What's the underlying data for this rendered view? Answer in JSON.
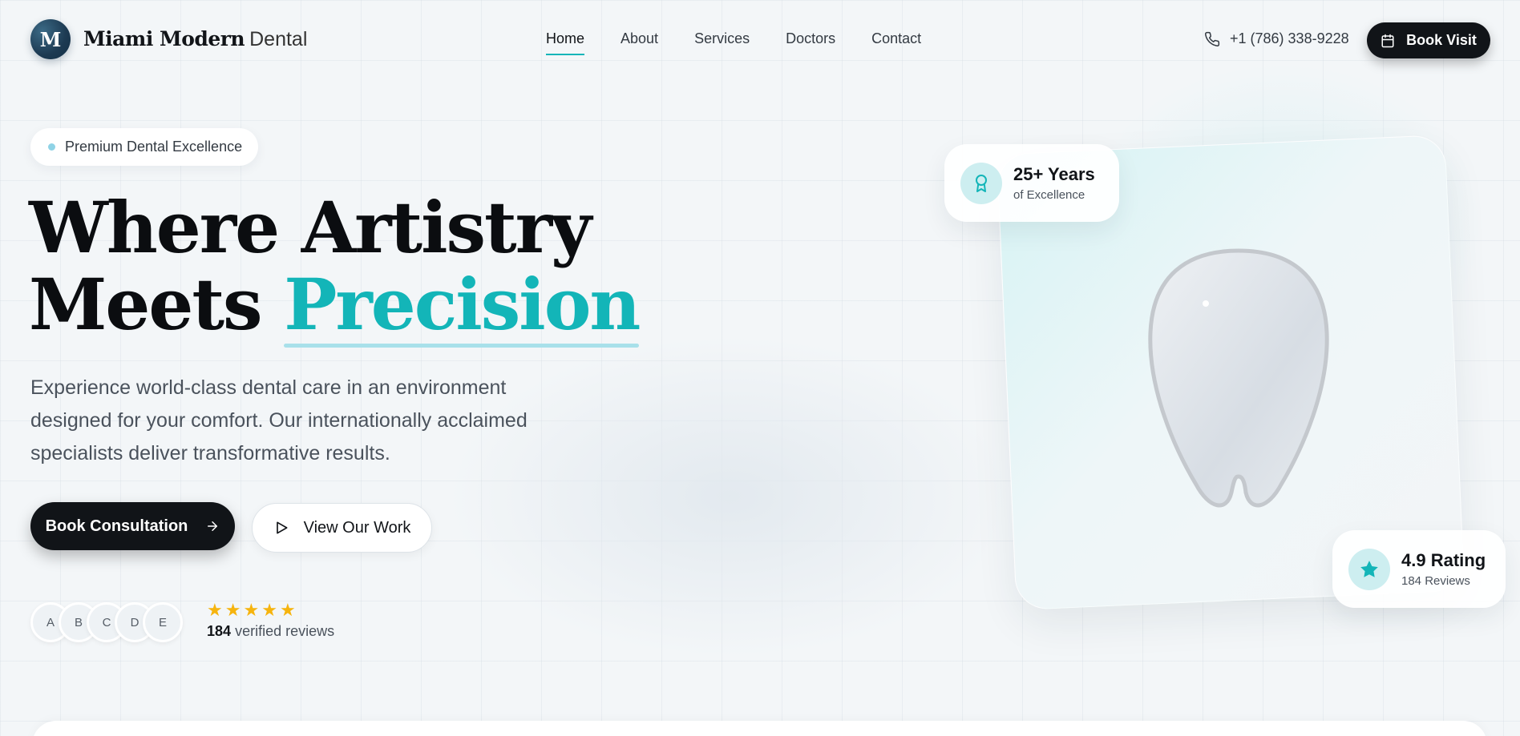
{
  "brand": {
    "mark": "M",
    "name_bold": "Miami Modern",
    "name_light": "Dental"
  },
  "nav": {
    "links": [
      "Home",
      "About",
      "Services",
      "Doctors",
      "Contact"
    ],
    "active": "Home",
    "phone": "+1 (786) 338-9228",
    "cta": "Book Visit"
  },
  "hero": {
    "pill": "Premium Dental Excellence",
    "headline_line1": "Where Artistry",
    "headline_line2_prefix": "Meets",
    "headline_accent": "Precision",
    "description": "Experience world-class dental care in an environment designed for your comfort. Our internationally acclaimed specialists deliver transformative results.",
    "primary_button": "Book Consultation",
    "secondary_button": "View Our Work",
    "avatars": [
      "A",
      "B",
      "C",
      "D",
      "E"
    ],
    "rating_stars": 5,
    "review_count": "184",
    "review_suffix": "verified reviews"
  },
  "badges": {
    "years_title": "25+ Years",
    "years_sub": "of Excellence",
    "rating_title": "4.9 Rating",
    "rating_sub": "184 Reviews"
  },
  "icons": {
    "phone": "phone-icon",
    "calendar": "calendar-icon",
    "arrow": "arrow-right-icon",
    "play": "play-icon",
    "award": "award-icon",
    "star": "star-icon"
  },
  "colors": {
    "accent": "#13b5b8",
    "dark": "#111418",
    "star": "#f6b40e"
  }
}
